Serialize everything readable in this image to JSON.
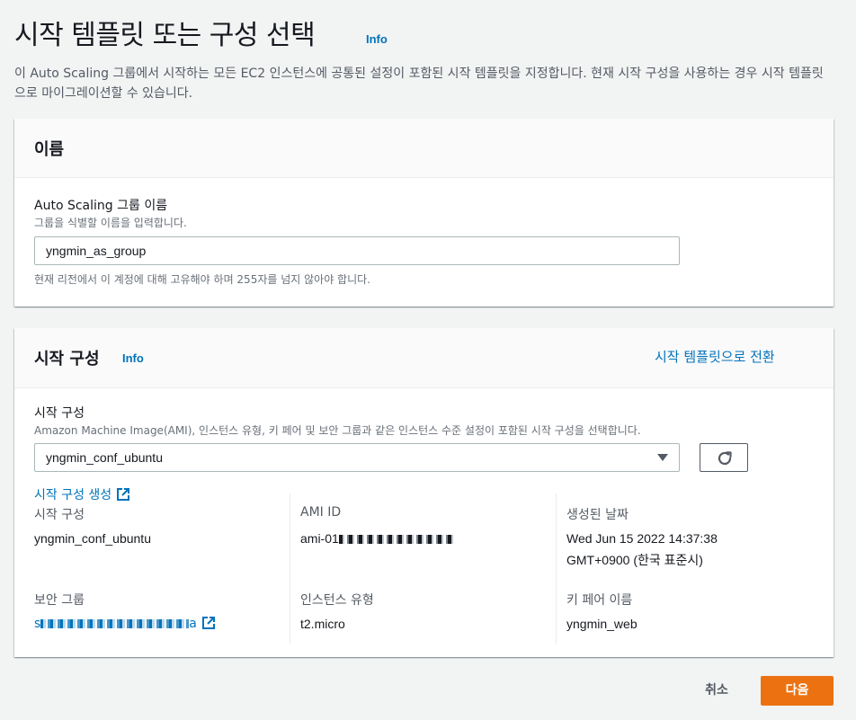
{
  "page": {
    "title": "시작 템플릿 또는 구성 선택",
    "info": "Info",
    "description": "이 Auto Scaling 그룹에서 시작하는 모든 EC2 인스턴스에 공통된 설정이 포함된 시작 템플릿을 지정합니다. 현재 시작 구성을 사용하는 경우 시작 템플릿으로 마이그레이션할 수 있습니다."
  },
  "name_section": {
    "title": "이름",
    "field_label": "Auto Scaling 그룹 이름",
    "field_hint": "그룹을 식별할 이름을 입력합니다.",
    "field_value": "yngmin_as_group",
    "constraint": "현재 리전에서 이 계정에 대해 고유해야 하며 255자를 넘지 않아야 합니다."
  },
  "launch_section": {
    "title": "시작 구성",
    "info": "Info",
    "switch_link": "시작 템플릿으로 전환",
    "field_label": "시작 구성",
    "field_hint": "Amazon Machine Image(AMI), 인스턴스 유형, 키 페어 및 보안 그룹과 같은 인스턴스 수준 설정이 포함된 시작 구성을 선택합니다.",
    "selected": "yngmin_conf_ubuntu",
    "create_link": "시작 구성 생성",
    "details": {
      "config_label": "시작 구성",
      "config_value": "yngmin_conf_ubuntu",
      "ami_label": "AMI ID",
      "ami_value": "ami-01",
      "created_label": "생성된 날짜",
      "created_line1": "Wed Jun 15 2022 14:37:38",
      "created_line2": "GMT+0900 (한국 표준시)",
      "sg_label": "보안 그룹",
      "sg_value_start": "s",
      "sg_value_end": "a",
      "instance_type_label": "인스턴스 유형",
      "instance_type_value": "t2.micro",
      "keypair_label": "키 페어 이름",
      "keypair_value": "yngmin_web"
    }
  },
  "footer": {
    "cancel": "취소",
    "next": "다음"
  },
  "colors": {
    "link": "#0073bb",
    "primary_button": "#ec7211",
    "background": "#f2f3f3"
  }
}
